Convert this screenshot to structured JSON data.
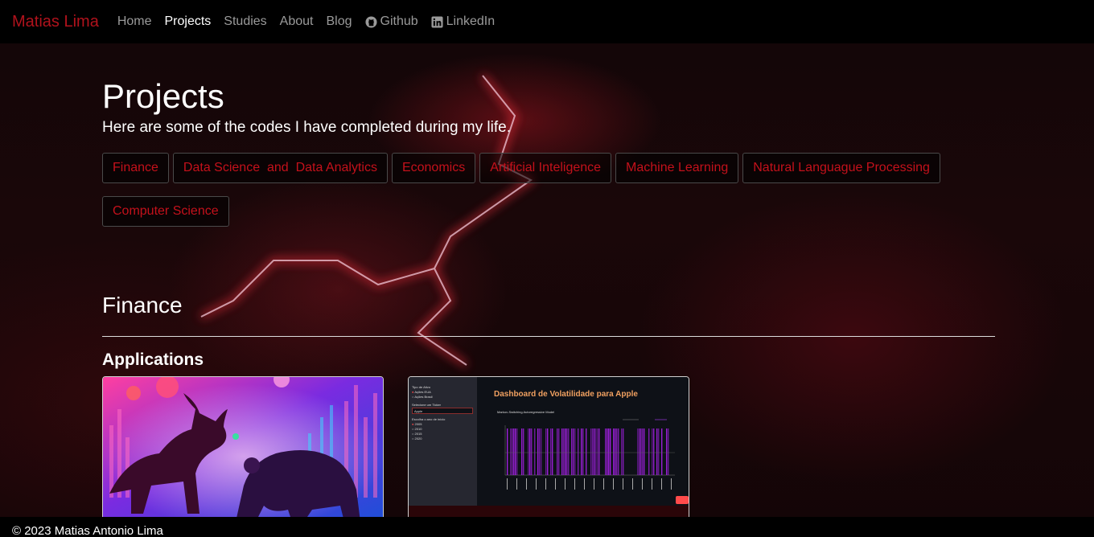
{
  "nav": {
    "brand": "Matias Lima",
    "items": [
      {
        "label": "Home"
      },
      {
        "label": "Projects"
      },
      {
        "label": "Studies"
      },
      {
        "label": "About"
      },
      {
        "label": "Blog"
      },
      {
        "label": "Github",
        "icon": "github-icon"
      },
      {
        "label": "LinkedIn",
        "icon": "linkedin-icon"
      }
    ],
    "active": "Projects"
  },
  "page": {
    "title": "Projects",
    "subtitle": "Here are some of the codes I have completed during my life."
  },
  "tags": [
    "Finance",
    "Data Science  and  Data Analytics",
    "Economics",
    "Artificial Inteligence",
    "Machine Learning",
    "Natural Languague Processing",
    "Computer Science"
  ],
  "section": {
    "title": "Finance",
    "subtitle": "Applications"
  },
  "cards": [
    {
      "image": "bull-vs-bear-illustration"
    },
    {
      "image": "volatility-dashboard-screenshot",
      "dashboard": {
        "title": "Dashboard de Volatilidade para Apple",
        "chart_title": "Markov-Switching Autoregressive Model",
        "sidebar": {
          "asset_type_label": "Tipo de Ativo",
          "asset_options": [
            "Ações EUA",
            "Ações Brasil"
          ],
          "ticker_label": "Selecione um Ticker",
          "ticker_value": "Apple",
          "year_label": "Escolha o ano de início",
          "year_options": [
            "2005",
            "2010",
            "2015",
            "2020"
          ]
        }
      }
    }
  ],
  "footer": {
    "text": "© 2023 Matias Antonio Lima"
  },
  "colors": {
    "accent": "#b0121c",
    "tag_text": "#c4111b",
    "nav_bg": "#000000"
  }
}
